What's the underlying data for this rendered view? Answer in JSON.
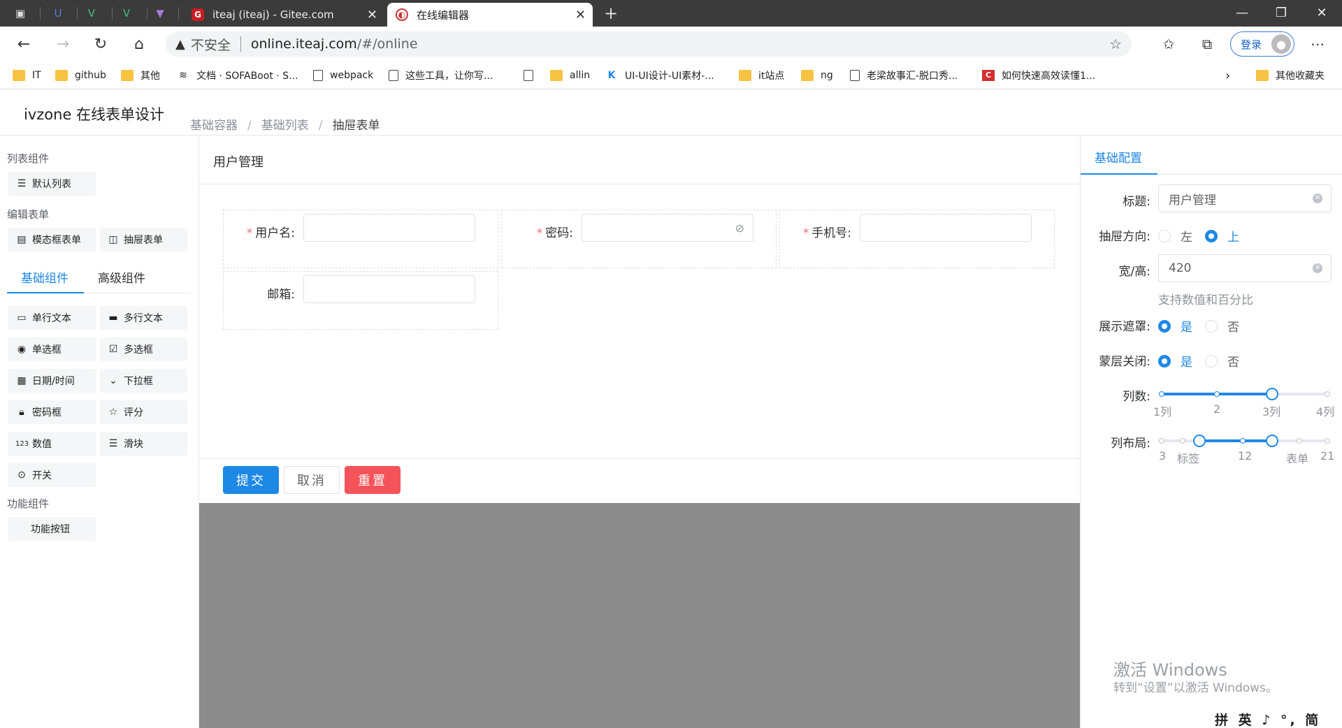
{
  "browser": {
    "tabs": [
      {
        "title": "iteaj (iteaj) - Gitee.com",
        "favicon": "gitee-icon",
        "active": false
      },
      {
        "title": "在线编辑器",
        "favicon": "editor-icon",
        "active": true
      }
    ],
    "address": {
      "warning": "不安全",
      "host": "online.iteaj.com",
      "path": "/#/online"
    },
    "login_label": "登录",
    "bookmarks": [
      "IT",
      "github",
      "其他",
      "文档 · SOFABoot · S...",
      "webpack",
      "这些工具，让你写...",
      "",
      "allin",
      "UI-UI设计-UI素材-...",
      "it站点",
      "ng",
      "老梁故事汇-脱口秀...",
      "如何快速高效读懂1..."
    ],
    "bookmarks_other": "其他收藏夹"
  },
  "app": {
    "title": "ivzone 在线表单设计",
    "breadcrumb": [
      "基础容器",
      "基础列表",
      "抽屉表单"
    ]
  },
  "left": {
    "list_group": "列表组件",
    "list_items": [
      "默认列表"
    ],
    "edit_group": "编辑表单",
    "edit_items": [
      "模态框表单",
      "抽屉表单"
    ],
    "tabs": [
      "基础组件",
      "高级组件"
    ],
    "basic_items": [
      "单行文本",
      "多行文本",
      "单选框",
      "多选框",
      "日期/时间",
      "下拉框",
      "密码框",
      "评分",
      "数值",
      "滑块",
      "开关"
    ],
    "func_group": "功能组件",
    "func_items": [
      "功能按钮"
    ]
  },
  "center": {
    "title": "用户管理",
    "fields": [
      {
        "label": "用户名:",
        "required": true,
        "value": ""
      },
      {
        "label": "密码:",
        "required": true,
        "value": ""
      },
      {
        "label": "手机号:",
        "required": true,
        "value": ""
      },
      {
        "label": "邮箱:",
        "required": false,
        "value": ""
      }
    ],
    "buttons": {
      "submit": "提交",
      "cancel": "取消",
      "reset": "重置"
    }
  },
  "right": {
    "tab": "基础配置",
    "title_label": "标题:",
    "title_value": "用户管理",
    "direction_label": "抽屉方向:",
    "direction_options": [
      "左",
      "上"
    ],
    "direction_selected": "上",
    "size_label": "宽/高:",
    "size_value": "420",
    "size_hint": "支持数值和百分比",
    "mask_label": "展示遮罩:",
    "mask_options": [
      "是",
      "否"
    ],
    "mask_selected": "是",
    "mask_close_label": "蒙层关闭:",
    "mask_close_options": [
      "是",
      "否"
    ],
    "mask_close_selected": "是",
    "columns_label": "列数:",
    "columns_marks": [
      "1列",
      "2",
      "3列",
      "4列"
    ],
    "columns_value": 3,
    "layout_label": "列布局:",
    "layout_marks": [
      "3",
      "标签",
      "12",
      "表单",
      "21"
    ],
    "layout_range": [
      6,
      18
    ]
  },
  "os": {
    "activate_title": "激活 Windows",
    "activate_sub": "转到“设置”以激活 Windows。",
    "ime": "拼 英 ♪ °, 简 ⚙"
  },
  "colors": {
    "primary": "#1e88e5",
    "danger": "#f5535a",
    "required": "#f56c6c",
    "mask": "#8c8c8c"
  }
}
